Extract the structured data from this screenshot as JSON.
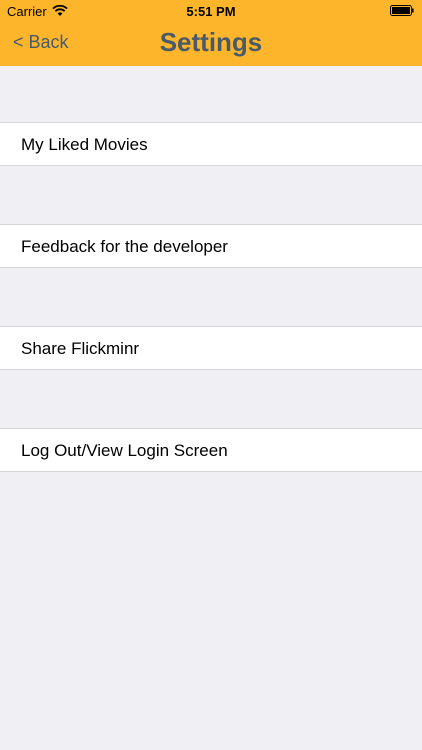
{
  "status_bar": {
    "carrier": "Carrier",
    "time": "5:51 PM",
    "wifi_icon": "wifi-icon",
    "battery_icon": "battery-icon"
  },
  "nav": {
    "back_label": "< Back",
    "title": "Settings",
    "bar_color": "#fdb62b",
    "text_color": "#4a5a68"
  },
  "settings": {
    "items": [
      {
        "label": "My Liked Movies"
      },
      {
        "label": "Feedback for the developer"
      },
      {
        "label": "Share Flickminr"
      },
      {
        "label": "Log Out/View Login Screen"
      }
    ]
  }
}
